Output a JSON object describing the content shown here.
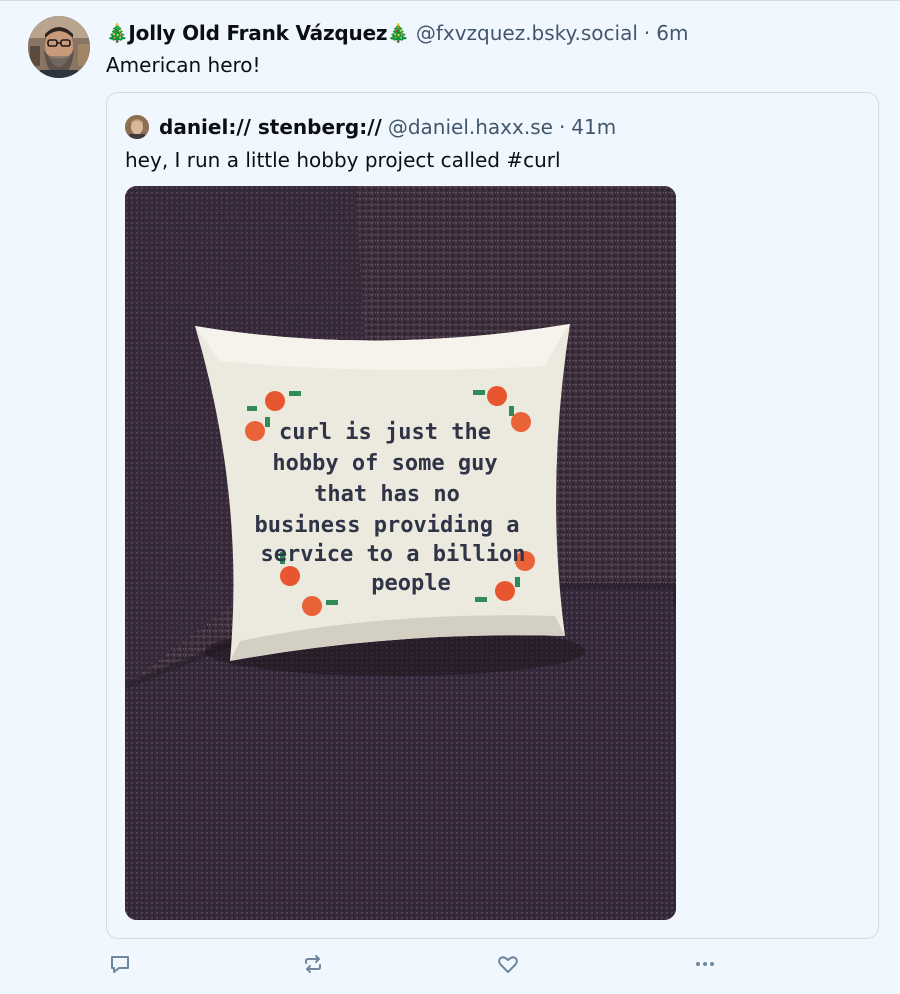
{
  "post": {
    "author": {
      "decoration_left": "🎄",
      "display_name": "Jolly Old Frank Vázquez",
      "decoration_right": "🎄",
      "handle": "@fxvzquez.bsky.social",
      "separator": "·",
      "time": "6m"
    },
    "text": "American hero!",
    "quote": {
      "author": {
        "display_name": "daniel:// stenberg://",
        "handle": "@daniel.haxx.se",
        "separator": "·",
        "time": "41m"
      },
      "text": "hey, I run a little hobby project called #curl",
      "image": {
        "embroidery_lines": [
          "curl is just the",
          "hobby of some guy",
          "that has no",
          "business providing a",
          "service to a billion",
          "people"
        ]
      }
    },
    "actions": [
      {
        "name": "reply",
        "icon": "speech-bubble-icon"
      },
      {
        "name": "repost",
        "icon": "repost-icon"
      },
      {
        "name": "like",
        "icon": "heart-icon"
      },
      {
        "name": "more",
        "icon": "ellipsis-icon"
      }
    ]
  },
  "colors": {
    "background": "#f1f7fe",
    "border": "#d4dbe2",
    "secondary_text": "#42576c",
    "primary_text": "#0b0f14",
    "icon": "#6f869f"
  }
}
